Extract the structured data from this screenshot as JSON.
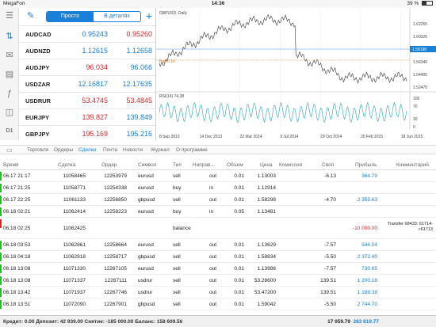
{
  "status": {
    "carrier": "MegaFon",
    "time": "14:36",
    "battery": "39 %",
    "battery_level": 0.39
  },
  "quotes": {
    "segment": [
      "Просто",
      "В деталях"
    ],
    "rows": [
      {
        "symbol": "AUDCAD",
        "bid": "0.95243",
        "ask": "0.95260",
        "bid_color": "blue",
        "ask_color": "red"
      },
      {
        "symbol": "AUDNZD",
        "bid": "1.12615",
        "ask": "1.12658",
        "bid_color": "blue",
        "ask_color": "blue"
      },
      {
        "symbol": "AUDJPY",
        "bid": "96.034",
        "ask": "96.066",
        "bid_color": "red",
        "ask_color": "blue"
      },
      {
        "symbol": "USDZAR",
        "bid": "12.16817",
        "ask": "12.17635",
        "bid_color": "blue",
        "ask_color": "blue"
      },
      {
        "symbol": "USDRUR",
        "bid": "53.4745",
        "ask": "53.4845",
        "bid_color": "red",
        "ask_color": "red"
      },
      {
        "symbol": "EURJPY",
        "bid": "139.827",
        "ask": "139.849",
        "bid_color": "red",
        "ask_color": "blue"
      },
      {
        "symbol": "GBPJPY",
        "bid": "195.169",
        "ask": "195.216",
        "bid_color": "red",
        "ask_color": "blue"
      }
    ]
  },
  "chart": {
    "title": "GBPUSD, Daily",
    "price_ticks": [
      "1.62255",
      "1.60320",
      "1.58410",
      "1.56340",
      "1.54405",
      "1.52470"
    ],
    "current_price": "1.58198",
    "buy_label": "Buy 0.14",
    "rsi_label": "RSI(14) 74.38",
    "rsi_ticks": [
      "100",
      "70",
      "30",
      "0"
    ],
    "dates": [
      "8 Sep 2013",
      "14 Dec 2013",
      "22 Mar 2014",
      "9 Jul 2014",
      "29 Oct 2014",
      "20 Feb 2015",
      "18 Jun 2015"
    ]
  },
  "tabs": [
    "Торговля",
    "Ордеры",
    "Сделки",
    "Почта",
    "Новости",
    "Журнал",
    "О программе"
  ],
  "columns": [
    "Время",
    "Сделка",
    "Ордер",
    "Символ",
    "Тип",
    "Направ...",
    "Объем",
    "Цена",
    "Комиссия",
    "Своп",
    "Прибыль",
    "Комментарий"
  ],
  "deals": [
    {
      "time": "06.17 21:17",
      "deal": "11058465",
      "order": "12253979",
      "symbol": "eurusd",
      "type": "sell",
      "dir": "out",
      "vol": "0.01",
      "price": "1.13003",
      "comm": "",
      "swap": "-6.13",
      "profit": "364.79",
      "comment": "",
      "mark": "green"
    },
    {
      "time": "06.17 21:25",
      "deal": "11058771",
      "order": "12254338",
      "symbol": "eurusd",
      "type": "buy",
      "dir": "in",
      "vol": "0.01",
      "price": "1.12914",
      "comm": "",
      "swap": "",
      "profit": "",
      "comment": "",
      "mark": "green"
    },
    {
      "time": "06.17 22:25",
      "deal": "11061133",
      "order": "12256850",
      "symbol": "gbpusd",
      "type": "sell",
      "dir": "out",
      "vol": "0.01",
      "price": "1.58298",
      "comm": "",
      "swap": "-4.70",
      "profit": "2 355.63",
      "comment": "",
      "mark": "green"
    },
    {
      "time": "06.18 02:21",
      "deal": "11062414",
      "order": "12258223",
      "symbol": "eurusd",
      "type": "buy",
      "dir": "in",
      "vol": "0.05",
      "price": "1.13481",
      "comm": "",
      "swap": "",
      "profit": "",
      "comment": "",
      "mark": "green"
    },
    {
      "time": "06.18 02:25",
      "deal": "11062425",
      "order": "",
      "symbol": "",
      "type": "balance",
      "dir": "",
      "vol": "",
      "price": "",
      "comm": "",
      "swap": "",
      "profit": "-10 000.00",
      "comment": "Transfer 68433: 61714->61713",
      "mark": "red"
    },
    {
      "time": "06.18 03:53",
      "deal": "11062861",
      "order": "12258664",
      "symbol": "eurusd",
      "type": "sell",
      "dir": "out",
      "vol": "0.01",
      "price": "1.13629",
      "comm": "",
      "swap": "-7.57",
      "profit": "544.04",
      "comment": "",
      "mark": "green"
    },
    {
      "time": "06.18 04:18",
      "deal": "11062918",
      "order": "12258717",
      "symbol": "gbpusd",
      "type": "sell",
      "dir": "out",
      "vol": "0.01",
      "price": "1.58834",
      "comm": "",
      "swap": "-5.50",
      "profit": "2 372.40",
      "comment": "",
      "mark": "green"
    },
    {
      "time": "06.18 13:08",
      "deal": "11071330",
      "order": "12267105",
      "symbol": "eurusd",
      "type": "sell",
      "dir": "out",
      "vol": "0.01",
      "price": "1.13986",
      "comm": "",
      "swap": "-7.57",
      "profit": "730.65",
      "comment": "",
      "mark": "green"
    },
    {
      "time": "06.18 13:08",
      "deal": "11071337",
      "order": "12267111",
      "symbol": "usdrur",
      "type": "sell",
      "dir": "out",
      "vol": "0.01",
      "price": "53.28600",
      "comm": "",
      "swap": "139.51",
      "profit": "1 200.18",
      "comment": "",
      "mark": "green"
    },
    {
      "time": "06.18 13:42",
      "deal": "11071937",
      "order": "12267746",
      "symbol": "usdrur",
      "type": "sell",
      "dir": "out",
      "vol": "0.01",
      "price": "53.47200",
      "comm": "",
      "swap": "139.51",
      "profit": "1 189.38",
      "comment": "",
      "mark": "green"
    },
    {
      "time": "06.18 13:51",
      "deal": "11072090",
      "order": "12267901",
      "symbol": "gbpusd",
      "type": "sell",
      "dir": "out",
      "vol": "0.01",
      "price": "1.59042",
      "comm": "",
      "swap": "-5.50",
      "profit": "2 744.70",
      "comment": "",
      "mark": "green"
    }
  ],
  "footer": {
    "summary": "Кредит: 0.00 Депозит: 42 939.00 Снятие: -185 000.00 Баланс: 158 609.56",
    "swap_total": "17 059.79",
    "profit_total": "283 610.77"
  }
}
